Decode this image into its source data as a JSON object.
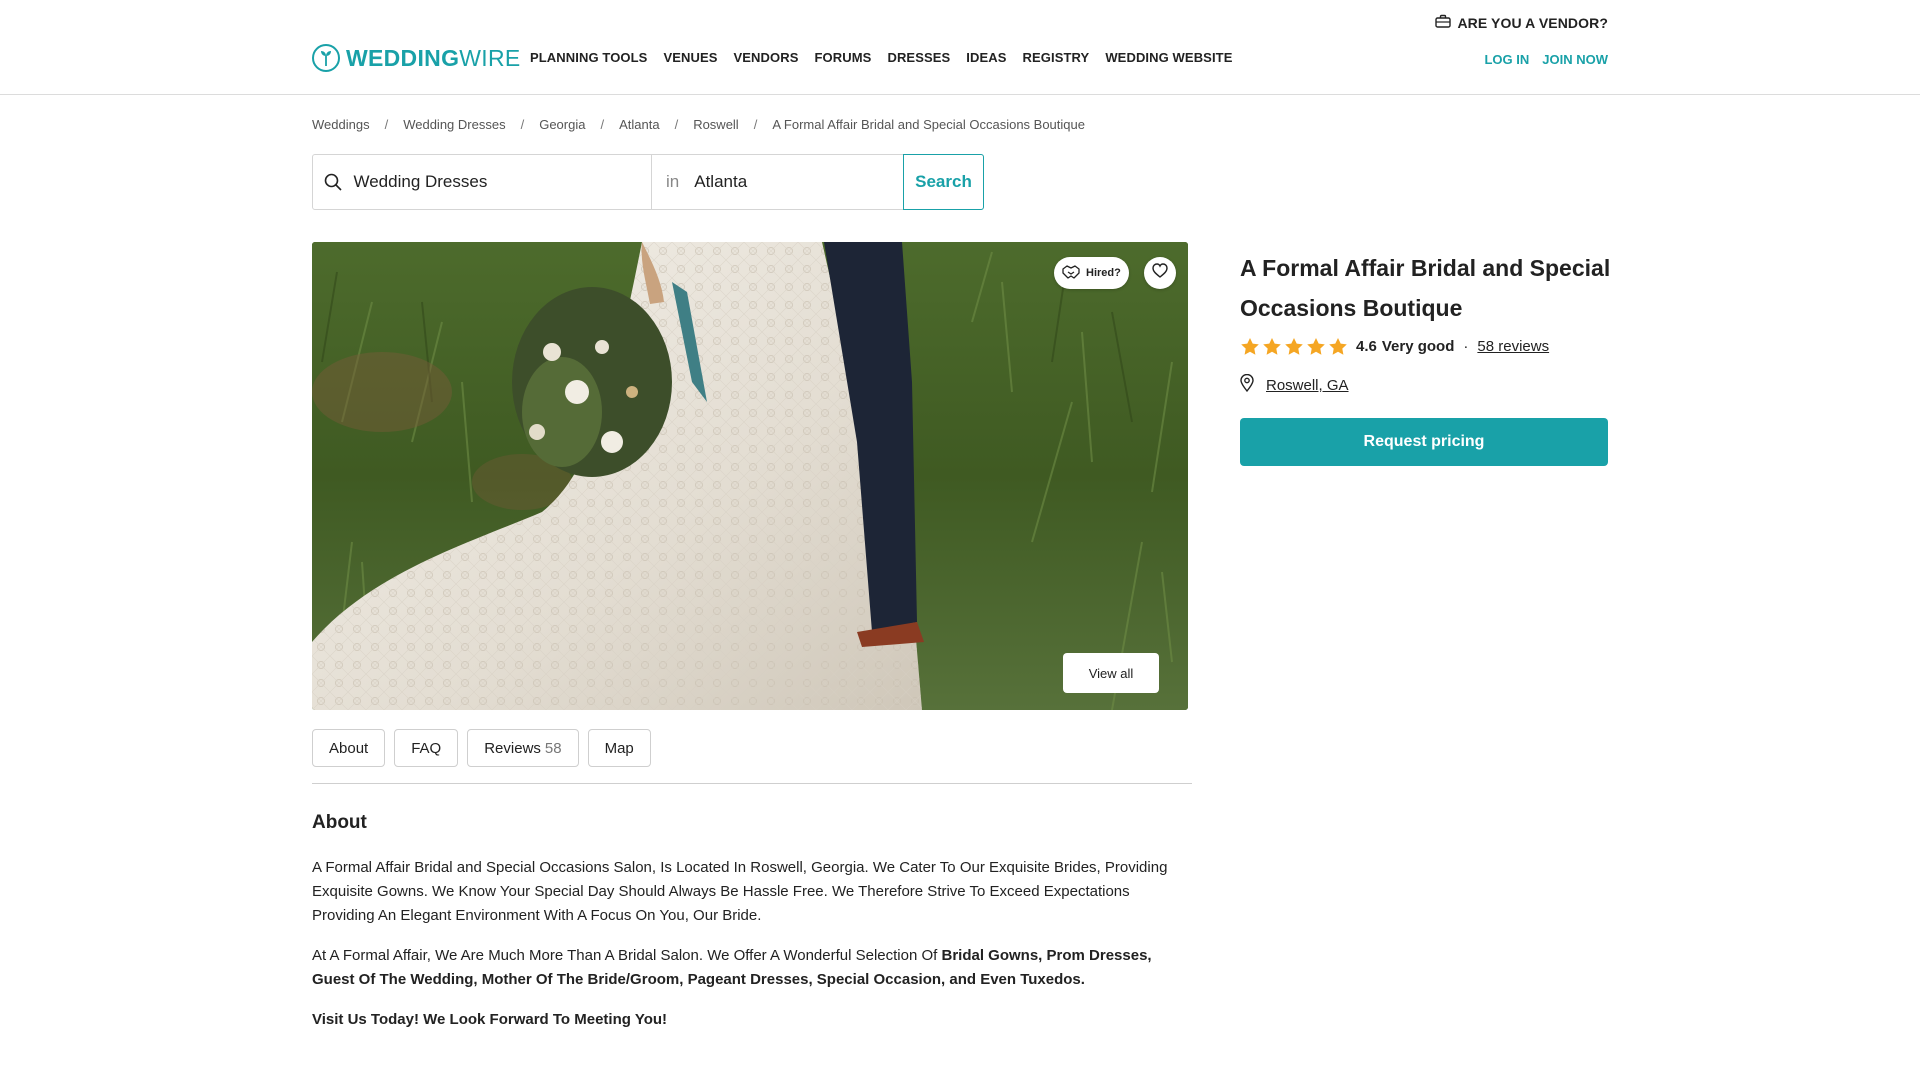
{
  "header": {
    "vendor_link": "ARE YOU A VENDOR?",
    "logo": {
      "part1": "WEDDING",
      "part2": "WIRE"
    },
    "nav": [
      "PLANNING TOOLS",
      "VENUES",
      "VENDORS",
      "FORUMS",
      "DRESSES",
      "IDEAS",
      "REGISTRY",
      "WEDDING WEBSITE"
    ],
    "login": "LOG IN",
    "join": "JOIN NOW"
  },
  "breadcrumb": [
    "Weddings",
    "Wedding Dresses",
    "Georgia",
    "Atlanta",
    "Roswell",
    "A Formal Affair Bridal and Special Occasions Boutique"
  ],
  "search": {
    "what_value": "Wedding Dresses",
    "in_label": "in",
    "where_value": "Atlanta",
    "button": "Search"
  },
  "gallery": {
    "hired_label": "Hired?",
    "view_all": "View all"
  },
  "tabs": [
    {
      "label": "About"
    },
    {
      "label": "FAQ"
    },
    {
      "label": "Reviews",
      "count": "58"
    },
    {
      "label": "Map"
    }
  ],
  "about": {
    "title": "About",
    "p1": "A Formal Affair Bridal and Special Occasions Salon, Is Located In Roswell, Georgia. We Cater To Our Exquisite Brides, Providing Exquisite Gowns. We Know Your Special Day Should Always Be Hassle Free. We Therefore Strive To Exceed Expectations Providing An Elegant Environment With A Focus On You, Our Bride.",
    "p2_lead": "At A Formal Affair, We Are Much More Than A Bridal Salon. We Offer A Wonderful Selection Of ",
    "p2_bold": "Bridal Gowns, Prom Dresses, Guest Of The Wedding, Mother Of The Bride/Groom, Pageant Dresses, Special Occasion, and Even Tuxedos.",
    "p3": "Visit Us Today! We Look Forward To Meeting You!"
  },
  "vendor": {
    "name": "A Formal Affair Bridal and Special Occasions Boutique",
    "rating_value": "4.6",
    "rating_label": "Very good",
    "stars": 5,
    "separator": "·",
    "reviews_link": "58 reviews",
    "location": "Roswell, GA",
    "cta": "Request pricing"
  },
  "colors": {
    "brand": "#19a1a8",
    "star": "#f5a623",
    "text": "#222222"
  },
  "icons": [
    "briefcase-icon",
    "logo-icon",
    "search-icon",
    "handshake-icon",
    "heart-icon",
    "star-icon",
    "map-pin-icon"
  ]
}
